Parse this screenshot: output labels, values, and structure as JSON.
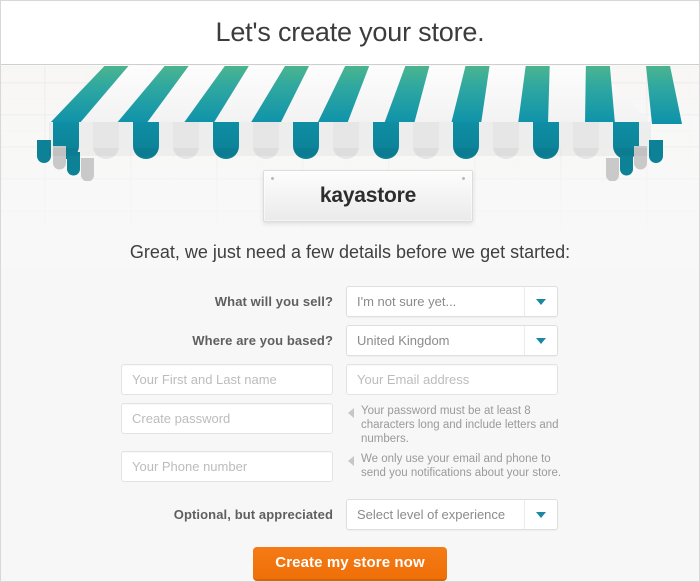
{
  "header": {
    "title": "Let's create your store."
  },
  "storefront": {
    "sign_text": "kayastore",
    "awning": {
      "stripe_color_top": "#51b98b",
      "stripe_color_bottom": "#0f93ab",
      "stripe_count": 16
    },
    "icons": {
      "screw_left": "screw-dot-icon",
      "screw_right": "screw-dot-icon"
    }
  },
  "form": {
    "subtitle": "Great, we just need a few details before we get started:",
    "fields": {
      "sell": {
        "label": "What will you sell?",
        "value": "I'm not sure yet...",
        "icon": "chevron-down-icon"
      },
      "based": {
        "label": "Where are you based?",
        "value": "United Kingdom",
        "icon": "chevron-down-icon"
      },
      "name": {
        "placeholder": "Your First and Last name",
        "value": ""
      },
      "email": {
        "placeholder": "Your Email address",
        "value": ""
      },
      "password": {
        "placeholder": "Create password",
        "value": "",
        "hint": "Your password must be at least 8 characters long and include letters and numbers.",
        "hint_icon": "triangle-pointer-icon"
      },
      "phone": {
        "placeholder": "Your Phone number",
        "value": "",
        "hint": "We only use your email and phone to send you notifications about your store.",
        "hint_icon": "triangle-pointer-icon"
      },
      "experience": {
        "label": "Optional, but appreciated",
        "value": "Select level of experience",
        "icon": "chevron-down-icon"
      }
    },
    "submit": {
      "label": "Create my store now",
      "color": "#f0700a"
    }
  },
  "colors": {
    "accent_teal": "#1b87a3",
    "accent_orange": "#f0700a",
    "text_dark": "#3c3c3c",
    "text_label": "#5f5f5f",
    "text_muted": "#9a9a9a"
  }
}
